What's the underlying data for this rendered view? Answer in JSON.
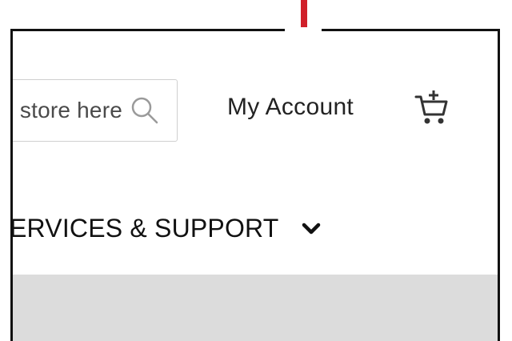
{
  "header": {
    "search": {
      "text": "store here",
      "icon": "search-icon"
    },
    "account": {
      "label": "My Account"
    },
    "cart": {
      "icon": "cart-add-icon"
    }
  },
  "nav": {
    "menu_item": {
      "label": "ERVICES & SUPPORT",
      "icon": "chevron-down-icon"
    }
  },
  "colors": {
    "annotation_arrow": "#d0202a",
    "frame_border": "#111111",
    "grey_band": "#dcdcdc"
  }
}
